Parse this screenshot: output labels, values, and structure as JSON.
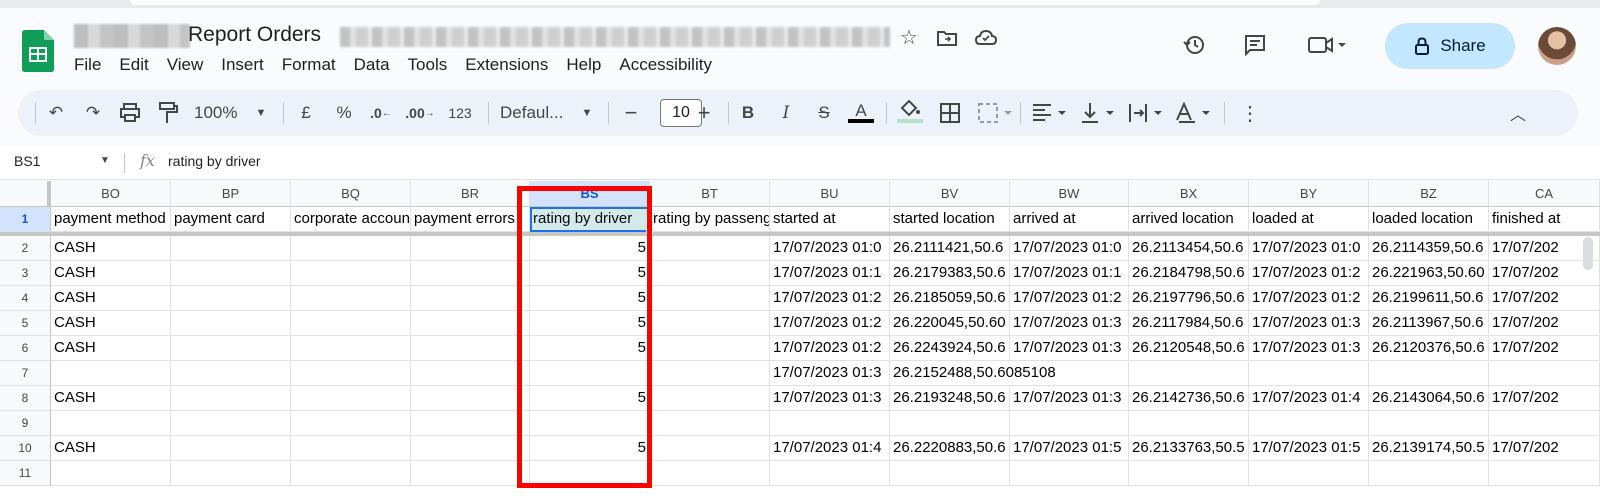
{
  "window": {
    "title_visible": "Report Orders"
  },
  "menu": [
    "File",
    "Edit",
    "View",
    "Insert",
    "Format",
    "Data",
    "Tools",
    "Extensions",
    "Help",
    "Accessibility"
  ],
  "header": {
    "share_label": "Share"
  },
  "toolbar": {
    "zoom": "100%",
    "currency": "£",
    "percent": "%",
    "dec_decrease": ".0",
    "dec_increase": ".00",
    "number_format": "123",
    "font": "Defaul...",
    "font_size": "10",
    "bold": "B",
    "italic": "I",
    "text_color_glyph": "A"
  },
  "formula_bar": {
    "cell_ref": "BS1",
    "fx": "fx",
    "content": "rating by driver"
  },
  "grid": {
    "columns": [
      "BO",
      "BP",
      "BQ",
      "BR",
      "BS",
      "BT",
      "BU",
      "BV",
      "BW",
      "BX",
      "BY",
      "BZ",
      "CA"
    ],
    "rows": [
      "1",
      "2",
      "3",
      "4",
      "5",
      "6",
      "7",
      "8",
      "9",
      "10",
      "11"
    ],
    "cells": [
      [
        "payment method",
        "payment card",
        "corporate account",
        "payment errors",
        "rating by driver",
        "rating by passenger",
        "started at",
        "started location",
        "arrived at",
        "arrived location",
        "loaded at",
        "loaded location",
        "finished at"
      ],
      [
        "CASH",
        "",
        "",
        "",
        "5",
        "",
        "17/07/2023 01:0",
        "26.2111421,50.6",
        "17/07/2023 01:0",
        "26.2113454,50.6",
        "17/07/2023 01:0",
        "26.2114359,50.6",
        "17/07/202"
      ],
      [
        "CASH",
        "",
        "",
        "",
        "5",
        "",
        "17/07/2023 01:1",
        "26.2179383,50.6",
        "17/07/2023 01:1",
        "26.2184798,50.6",
        "17/07/2023 01:2",
        "26.221963,50.60",
        "17/07/202"
      ],
      [
        "CASH",
        "",
        "",
        "",
        "5",
        "",
        "17/07/2023 01:2",
        "26.2185059,50.6",
        "17/07/2023 01:2",
        "26.2197796,50.6",
        "17/07/2023 01:2",
        "26.2199611,50.6",
        "17/07/202"
      ],
      [
        "CASH",
        "",
        "",
        "",
        "5",
        "",
        "17/07/2023 01:2",
        "26.220045,50.60",
        "17/07/2023 01:3",
        "26.2117984,50.6",
        "17/07/2023 01:3",
        "26.2113967,50.6",
        "17/07/202"
      ],
      [
        "CASH",
        "",
        "",
        "",
        "5",
        "",
        "17/07/2023 01:2",
        "26.2243924,50.6",
        "17/07/2023 01:3",
        "26.2120548,50.6",
        "17/07/2023 01:3",
        "26.2120376,50.6",
        "17/07/202"
      ],
      [
        "",
        "",
        "",
        "",
        "",
        "",
        "17/07/2023 01:3",
        "26.2152488,50.6085108",
        "",
        "",
        "",
        "",
        ""
      ],
      [
        "CASH",
        "",
        "",
        "",
        "5",
        "",
        "17/07/2023 01:3",
        "26.2193248,50.6",
        "17/07/2023 01:3",
        "26.2142736,50.6",
        "17/07/2023 01:4",
        "26.2143064,50.6",
        "17/07/202"
      ],
      [
        "",
        "",
        "",
        "",
        "",
        "",
        "",
        "",
        "",
        "",
        "",
        "",
        ""
      ],
      [
        "CASH",
        "",
        "",
        "",
        "5",
        "",
        "17/07/2023 01:4",
        "26.2220883,50.6",
        "17/07/2023 01:5",
        "26.2133763,50.5",
        "17/07/2023 01:5",
        "26.2139174,50.5",
        "17/07/202"
      ],
      [
        "",
        "",
        "",
        "",
        "",
        "",
        "",
        "",
        "",
        "",
        "",
        "",
        ""
      ]
    ]
  },
  "colors": {
    "accent": "#1a73e8",
    "share_bg": "#c2e7ff",
    "highlight": "#ff0000",
    "sheets_green": "#0f9d58"
  }
}
